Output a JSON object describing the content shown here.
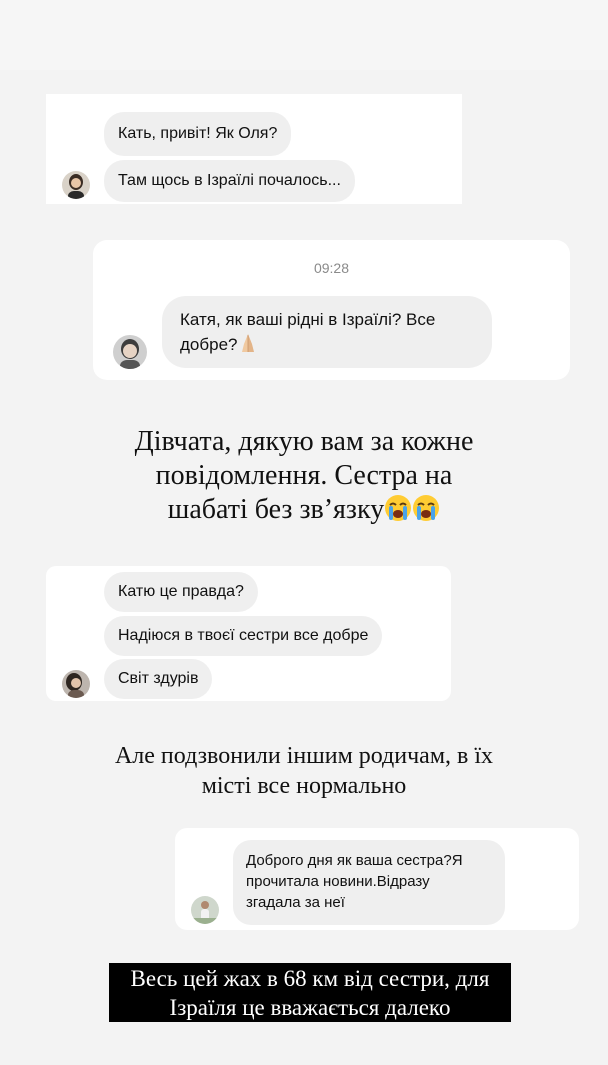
{
  "story": {
    "chat1": {
      "messages": [
        "Кать, привіт! Як Оля?",
        "Там щось в Ізраїлі почалось..."
      ]
    },
    "chat2": {
      "time": "09:28",
      "message_line1": "Катя, як ваші рідні в Ізраїлі? Все",
      "message_line2": "добре?",
      "emoji": "praying-hands-emoji"
    },
    "caption1": {
      "line1": "Дівчата, дякую вам за кожне",
      "line2": "повідомлення. Сестра на",
      "line3": "шабаті без зв’язку",
      "emoji": "loudly-crying-face-emoji"
    },
    "chat3": {
      "messages": [
        "Катю це правда?",
        "Надіюся в твоєї сестри все добре",
        "Світ здурів"
      ]
    },
    "caption2": {
      "line1": "Але подзвонили іншим родичам, в їх",
      "line2": "місті все нормально"
    },
    "chat4": {
      "line1": "Доброго дня як ваша сестра?Я",
      "line2": "прочитала новини.Відразу",
      "line3": "згадала за неї"
    },
    "caption3": {
      "line1": "Весь цей жах в 68 км від сестри, для",
      "line2": "Ізраїля це вважається далеко"
    }
  },
  "colors": {
    "background": "#f3f3f3",
    "bubble": "#efefef",
    "timestamp": "#8a8a8a",
    "caption_box": "#000000"
  }
}
